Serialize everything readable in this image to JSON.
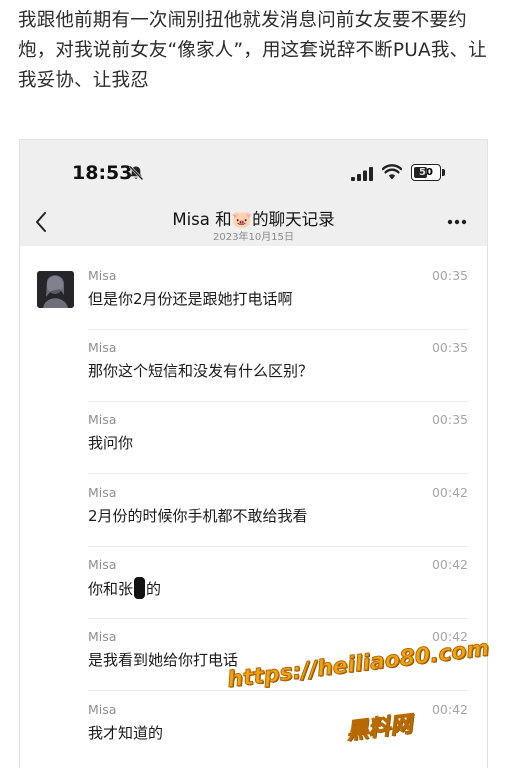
{
  "post": {
    "text": "我跟他前期有一次闹别扭他就发消息问前女友要不要约炮，对我说前女友“像家人”，用这套说辞不断PUA我、让我妥协、让我忍"
  },
  "status_bar": {
    "time": "18:53",
    "battery": "50",
    "battery_level": 0.5,
    "icons": [
      "bell-slash-icon",
      "signal-icon",
      "wifi-icon",
      "battery-icon"
    ]
  },
  "nav": {
    "title_prefix": "Misa 和",
    "title_emoji": "🐷",
    "title_suffix": "的聊天记录",
    "date": "2023年10月15日",
    "icons": [
      "back-chevron-icon",
      "more-dots-icon"
    ]
  },
  "messages": [
    {
      "sender": "Misa",
      "time": "00:35",
      "text": "但是你2月份还是跟她打电话啊"
    },
    {
      "sender": "Misa",
      "time": "00:35",
      "text": "那你这个短信和没发有什么区别？"
    },
    {
      "sender": "Misa",
      "time": "00:35",
      "text": "我问你"
    },
    {
      "sender": "Misa",
      "time": "00:42",
      "text": "2月份的时候你手机都不敢给我看"
    },
    {
      "sender": "Misa",
      "time": "00:42",
      "text_before": "你和张",
      "text_after": "的"
    },
    {
      "sender": "Misa",
      "time": "00:42",
      "text": "是我看到她给你打电话"
    },
    {
      "sender": "Misa",
      "time": "00:42",
      "text": "我才知道的"
    }
  ],
  "watermark": {
    "url": "https://heiliao80.com",
    "name": "黑料网"
  },
  "colors": {
    "header_bg": "#efefef",
    "watermark": "#f0a314"
  }
}
